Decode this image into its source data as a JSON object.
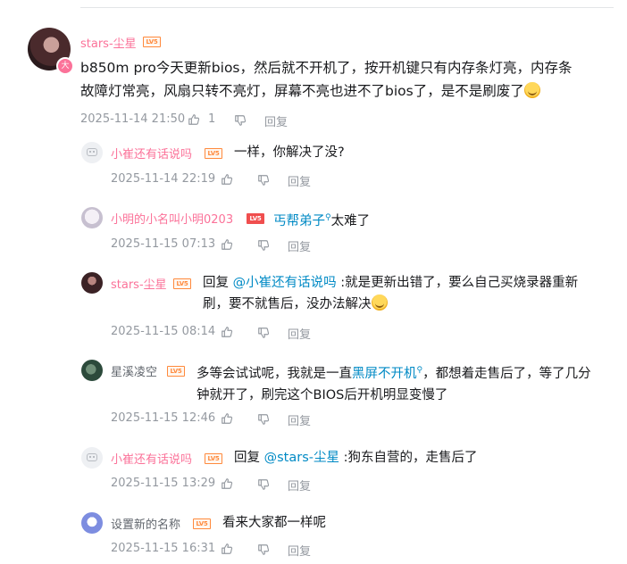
{
  "main_comment": {
    "username": "stars-尘星",
    "level": "LV5",
    "avatar_badge": "大",
    "text": "b850m pro今天更新bios，然后就不开机了，按开机键只有内存条灯亮，内存条故障灯常亮，风扇只转不亮灯，屏幕不亮也进不了bios了，是不是刷废了",
    "time": "2025-11-14 21:50",
    "likes": "1",
    "reply_label": "回复"
  },
  "replies": [
    {
      "username": "小崔还有话说吗",
      "level": "LV5",
      "text": "一样，你解决了没?",
      "time": "2025-11-14 22:19",
      "reply_label": "回复"
    },
    {
      "username": "小明的小名叫小明0203",
      "level": "LV5",
      "keyword": "丐帮弟子",
      "keyword_suffix": "太难了",
      "time": "2025-11-15 07:13",
      "reply_label": "回复"
    },
    {
      "username": "stars-尘星",
      "level": "LV5",
      "prefix": "回复",
      "mention": "@小崔还有话说吗",
      "text": " :就是更新出错了，要么自己买烧录器重新刷，要不就售后，没办法解决",
      "time": "2025-11-15 08:14",
      "reply_label": "回复"
    },
    {
      "username": "星溪凌空",
      "level": "LV5",
      "text_before": "多等会试试呢，我就是一直",
      "keyword": "黑屏不开机",
      "text_after": "，都想着走售后了，等了几分钟就开了，刷完这个BIOS后开机明显变慢了",
      "time": "2025-11-15 12:46",
      "reply_label": "回复"
    },
    {
      "username": "小崔还有话说吗",
      "level": "LV5",
      "prefix": "回复",
      "mention": "@stars-尘星",
      "text": " :狗东自营的，走售后了",
      "time": "2025-11-15 13:29",
      "reply_label": "回复"
    },
    {
      "username": "设置新的名称",
      "level": "LV5",
      "text": "看来大家都一样呢",
      "time": "2025-11-15 16:31",
      "reply_label": "回复"
    }
  ]
}
